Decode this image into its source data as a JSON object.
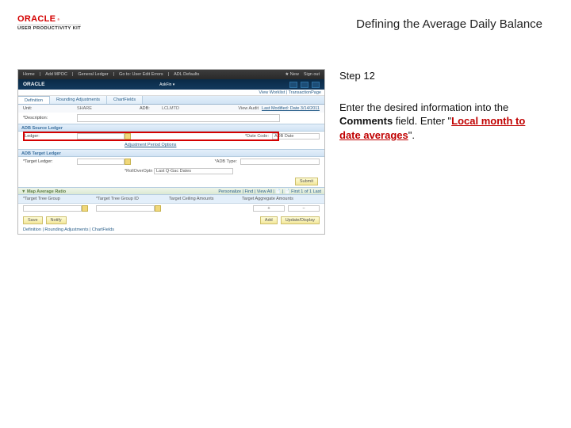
{
  "brand": {
    "logo_word": "ORACLE",
    "tm": "®",
    "subtitle": "USER PRODUCTIVITY KIT"
  },
  "page": {
    "title": "Defining the Average Daily Balance"
  },
  "instructions": {
    "step_label": "Step 12",
    "line1a": "Enter the desired information into the ",
    "line1b": "Comments",
    "line1c": " field. Enter \"",
    "highlight": "Local month to date averages",
    "line1d": "\"."
  },
  "app": {
    "topbar": {
      "home": "Home",
      "a": "Add MPOC",
      "b": "General Ledger",
      "c": "Go to: User Edit Errors",
      "d": "ADL Defaults",
      "star": "★ New",
      "signout": "Sign out"
    },
    "oracle_brand": "ORACLE",
    "tinylinks": "View Worklist | TransactionPage",
    "tabs": {
      "t1": "Definition",
      "t2": "Rounding Adjustments",
      "t3": "ChartFields"
    },
    "unit_row": {
      "lbl": "Unit:",
      "val": "SHARE",
      "lbl2": "ADB:",
      "val2": "LCLMTD"
    },
    "view_audit": {
      "label": "View Audit",
      "link": "Last Modified: Date 3/14/2011"
    },
    "desc": {
      "label": "*Description:",
      "field_hint": ""
    },
    "sect_src": "ADB Source Ledger",
    "src": {
      "label": "*Ledger:",
      "field_hint": "",
      "rlabel": "*Date Code:",
      "rval": "ADB Date",
      "sub": "Adjustment Period Options"
    },
    "sect_tgt": "ADB Target Ledger",
    "tgt": {
      "label": "*Target Ledger:",
      "rlabel": "*ADB Type:",
      "sub_label": "*RollOverOptn",
      "sub_val": "Last Q-Gac Dates"
    },
    "submit": "Submit",
    "sect_tree": "▼ Map Average Ratio",
    "tree_links": "Personalize | Find | View All | 📄 | 📄    First 1 of 1 Last",
    "hdr": {
      "a": "*Target Tree Group",
      "b": "*Target Tree Group ID",
      "c": "Target Ceiling Amounts",
      "d": "Target Aggregate Amounts"
    },
    "tree_row": {
      "plus": "+",
      "minus": "−"
    },
    "actions": {
      "save": "Save",
      "notify": "Notify",
      "add": "Add",
      "update": "Update/Display"
    },
    "footer_tabs": "Definition | Rounding Adjustments | ChartFields"
  }
}
